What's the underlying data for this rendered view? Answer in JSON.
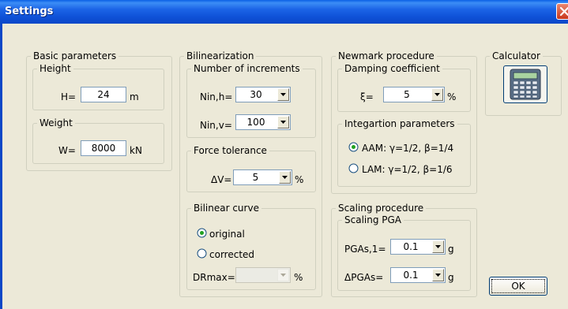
{
  "window": {
    "title": "Settings"
  },
  "basic": {
    "legend": "Basic parameters",
    "height": {
      "legend": "Height",
      "label": "H=",
      "value": "24",
      "unit": "m"
    },
    "weight": {
      "legend": "Weight",
      "label": "W=",
      "value": "8000",
      "unit": "kN"
    }
  },
  "bilin": {
    "legend": "Bilinearization",
    "increments": {
      "legend": "Number of increments",
      "nh_label": "Nin,h=",
      "nh_value": "30",
      "nv_label": "Nin,v=",
      "nv_value": "100"
    },
    "force": {
      "legend": "Force tolerance",
      "label": "ΔV=",
      "value": "5",
      "unit": "%"
    },
    "curve": {
      "legend": "Bilinear curve",
      "original": "original",
      "corrected": "corrected",
      "selected": "original",
      "drmax_label": "DRmax=",
      "drmax_value": "",
      "drmax_unit": "%"
    }
  },
  "newmark": {
    "legend": "Newmark procedure",
    "damping": {
      "legend": "Damping coefficient",
      "label": "ξ=",
      "value": "5",
      "unit": "%"
    },
    "integration": {
      "legend": "Integartion parameters",
      "aam": "AAM: γ=1/2, β=1/4",
      "lam": "LAM: γ=1/2, β=1/6",
      "selected": "AAM"
    }
  },
  "scaling": {
    "legend": "Scaling procedure",
    "pga": {
      "legend": "Scaling PGA",
      "pgas_label": "PGAs,1=",
      "pgas_value": "0.1",
      "pgas_unit": "g",
      "dpgas_label": "ΔPGAs=",
      "dpgas_value": "0.1",
      "dpgas_unit": "g"
    }
  },
  "calculator": {
    "legend": "Calculator",
    "icon": "calculator-icon"
  },
  "buttons": {
    "ok": "OK"
  },
  "colors": {
    "titlebar": "#0a5fe4",
    "background": "#ece9d8",
    "close": "#c9371c"
  }
}
